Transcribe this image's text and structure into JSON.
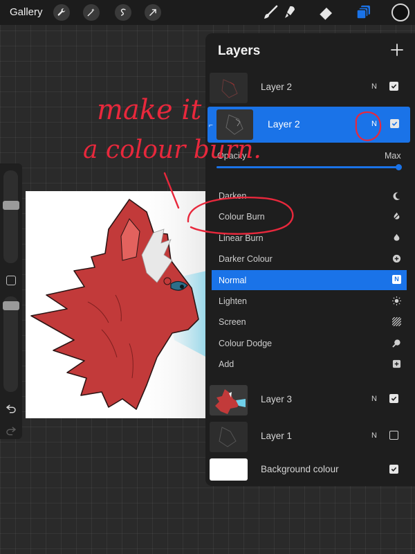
{
  "toolbar": {
    "gallery_label": "Gallery",
    "left_tools": [
      "wrench-icon",
      "magic-wand-icon",
      "selection-icon",
      "transform-icon"
    ],
    "right_tools": [
      "brush-icon",
      "smudge-icon",
      "eraser-icon",
      "layers-icon"
    ],
    "active_tool": "layers-icon",
    "current_color": "#111111"
  },
  "sidebar": {
    "brush_size_level": 0.2,
    "opacity_level": 0.05
  },
  "layers_panel": {
    "title": "Layers",
    "opacity": {
      "label": "Opacity",
      "max_label": "Max",
      "value": 1.0
    },
    "layers_top": [
      {
        "name": "Layer 2",
        "mode": "N",
        "visible": true
      },
      {
        "name": "Layer 2",
        "mode": "N",
        "visible": true,
        "selected": true
      }
    ],
    "blend_modes": [
      {
        "name": "Darken",
        "icon": "moon-icon"
      },
      {
        "name": "Colour Burn",
        "icon": "burn-icon"
      },
      {
        "name": "Linear Burn",
        "icon": "flame-icon"
      },
      {
        "name": "Darker Colour",
        "icon": "plus-circle-icon"
      },
      {
        "name": "Normal",
        "icon": "n-badge-icon",
        "active": true,
        "badge": "N"
      },
      {
        "name": "Lighten",
        "icon": "sun-icon"
      },
      {
        "name": "Screen",
        "icon": "hatch-icon"
      },
      {
        "name": "Colour Dodge",
        "icon": "magnifier-icon"
      },
      {
        "name": "Add",
        "icon": "plus-square-icon"
      }
    ],
    "layers_bottom": [
      {
        "name": "Layer 3",
        "mode": "N",
        "visible": true
      },
      {
        "name": "Layer 1",
        "mode": "N",
        "visible": false
      }
    ],
    "background": {
      "name": "Background colour",
      "visible": true,
      "color": "#ffffff"
    }
  },
  "annotation": {
    "line1": "make it",
    "line2": "a colour burn.",
    "color": "#e8283c"
  },
  "colors": {
    "accent": "#1a73e8",
    "panel": "#1e1e1e",
    "canvas_bg": "#2a2a2a",
    "fox_red": "#c23a3a"
  }
}
